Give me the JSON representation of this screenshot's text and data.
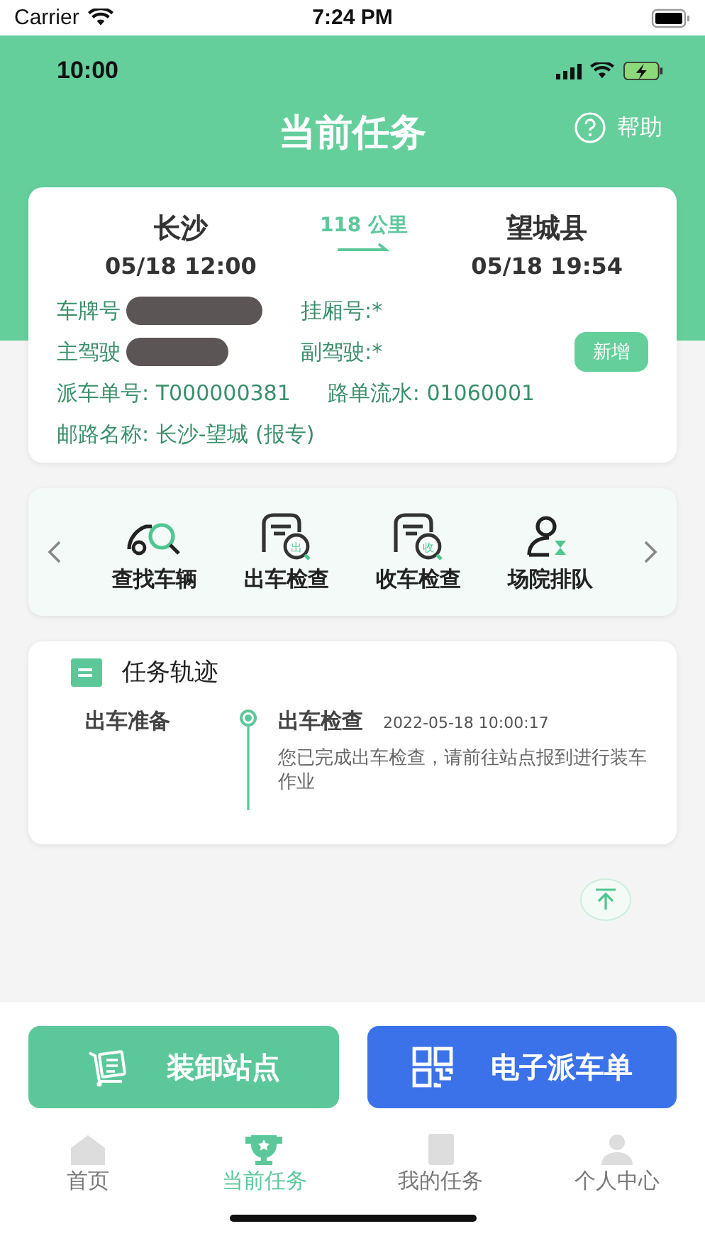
{
  "device_status": {
    "carrier": "Carrier",
    "time": "7:24 PM"
  },
  "app_status": {
    "time": "10:00"
  },
  "header": {
    "title": "当前任务",
    "help": "帮助"
  },
  "trip": {
    "origin": "长沙",
    "origin_time": "05/18 12:00",
    "distance": "118 公里",
    "destination": "望城县",
    "destination_time": "05/18 19:54",
    "fields": [
      {
        "label": "车牌号",
        "redacted": true
      },
      {
        "label": "挂厢号:",
        "value": "*",
        "redacted": false
      },
      {
        "label": "主驾驶",
        "redacted": true
      },
      {
        "label": "副驾驶:",
        "value": "*",
        "redacted": false
      }
    ],
    "add_button": "新增",
    "dispatch": "派车单号: T000000381",
    "waybill": "路单流水: 01060001",
    "route": "邮路名称: 长沙-望城 (报专)"
  },
  "actions": [
    {
      "kind": "search-car",
      "label": "查找车辆"
    },
    {
      "kind": "depart",
      "label": "出车检查",
      "badge": "出"
    },
    {
      "kind": "return",
      "label": "收车检查",
      "badge": "收"
    },
    {
      "kind": "queue",
      "label": "场院排队"
    }
  ],
  "track": {
    "title": "任务轨迹",
    "stage": "出车准备",
    "step": "出车检查",
    "time": "2022-05-18 10:00:17",
    "note": "您已完成出车检查，请前往站点报到进行装车作业"
  },
  "bottom_buttons": [
    {
      "kind": "stations",
      "label": "装卸站点"
    },
    {
      "kind": "qr",
      "label": "电子派车单"
    }
  ],
  "tabs": [
    {
      "kind": "home",
      "label": "首页",
      "selected": false
    },
    {
      "kind": "trophy",
      "label": "当前任务",
      "selected": true
    },
    {
      "kind": "doc",
      "label": "我的任务",
      "selected": false
    },
    {
      "kind": "person",
      "label": "个人中心",
      "selected": false
    }
  ]
}
